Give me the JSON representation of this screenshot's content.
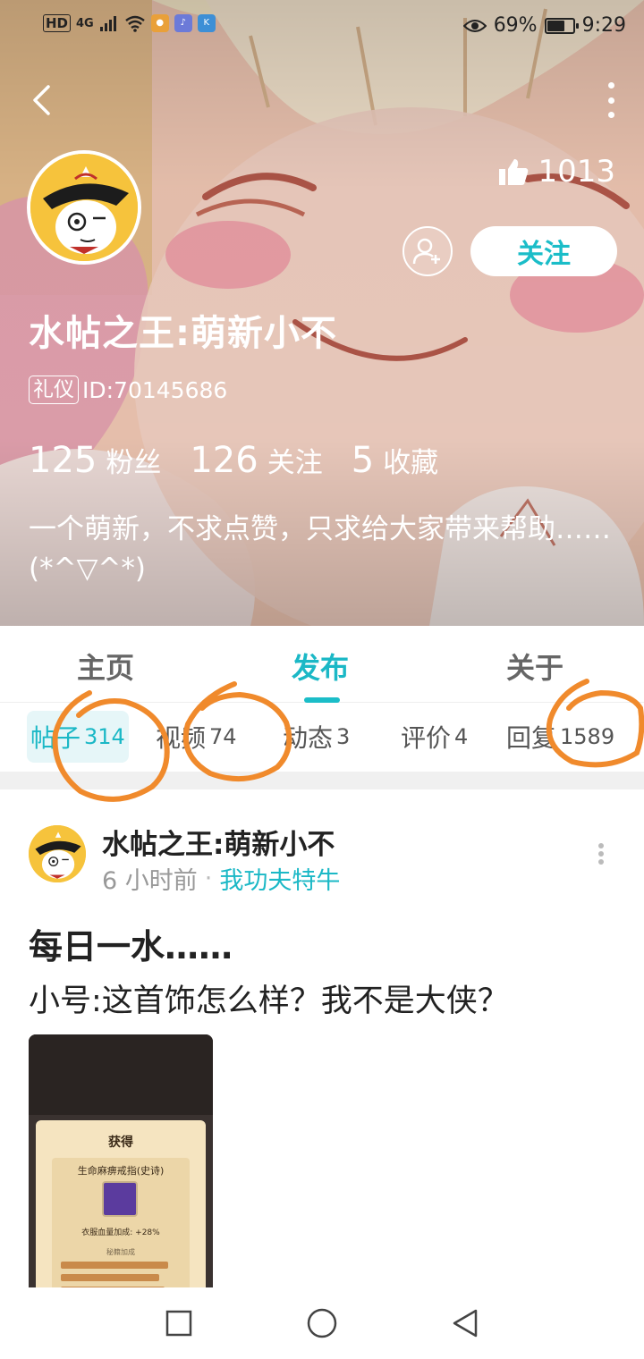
{
  "status_bar": {
    "hd": "HD",
    "network": "4G",
    "battery_percent": "69%",
    "time": "9:29"
  },
  "header": {
    "likes_count": "1013",
    "follow_label": "关注",
    "username": "水帖之王:萌新小不",
    "badge": "礼仪",
    "user_id": "ID:70145686",
    "stats": [
      {
        "num": "125",
        "label": "粉丝"
      },
      {
        "num": "126",
        "label": "关注"
      },
      {
        "num": "5",
        "label": "收藏"
      }
    ],
    "bio": "一个萌新，不求点赞，只求给大家带来帮助…… (*^▽^*)"
  },
  "main_tabs": [
    {
      "label": "主页"
    },
    {
      "label": "发布"
    },
    {
      "label": "关于"
    }
  ],
  "sub_tabs": [
    {
      "label": "帖子",
      "count": "314"
    },
    {
      "label": "视频",
      "count": "74"
    },
    {
      "label": "动态",
      "count": "3"
    },
    {
      "label": "评价",
      "count": "4"
    },
    {
      "label": "回复",
      "count": "1589"
    }
  ],
  "post": {
    "author": "水帖之王:萌新小不",
    "time_ago": "6 小时前",
    "dot": "·",
    "topic": "我功夫特牛",
    "title": "每日一水……",
    "body": "小号:这首饰怎么样？我不是大侠？",
    "image": {
      "header": "获得",
      "item_name": "生命麻痹戒指(史诗)",
      "item_stat": "衣服血量加成: +28%",
      "section": "秘籍加成"
    }
  },
  "colors": {
    "accent": "#1bbdc8",
    "scribble": "#f08a2c"
  },
  "icons": {
    "back": "chevron-left-icon",
    "more": "more-vertical-icon",
    "like": "thumbs-up-icon",
    "add_friend": "add-user-icon",
    "nav_recent": "square-icon",
    "nav_home": "circle-icon",
    "nav_back": "triangle-back-icon"
  }
}
